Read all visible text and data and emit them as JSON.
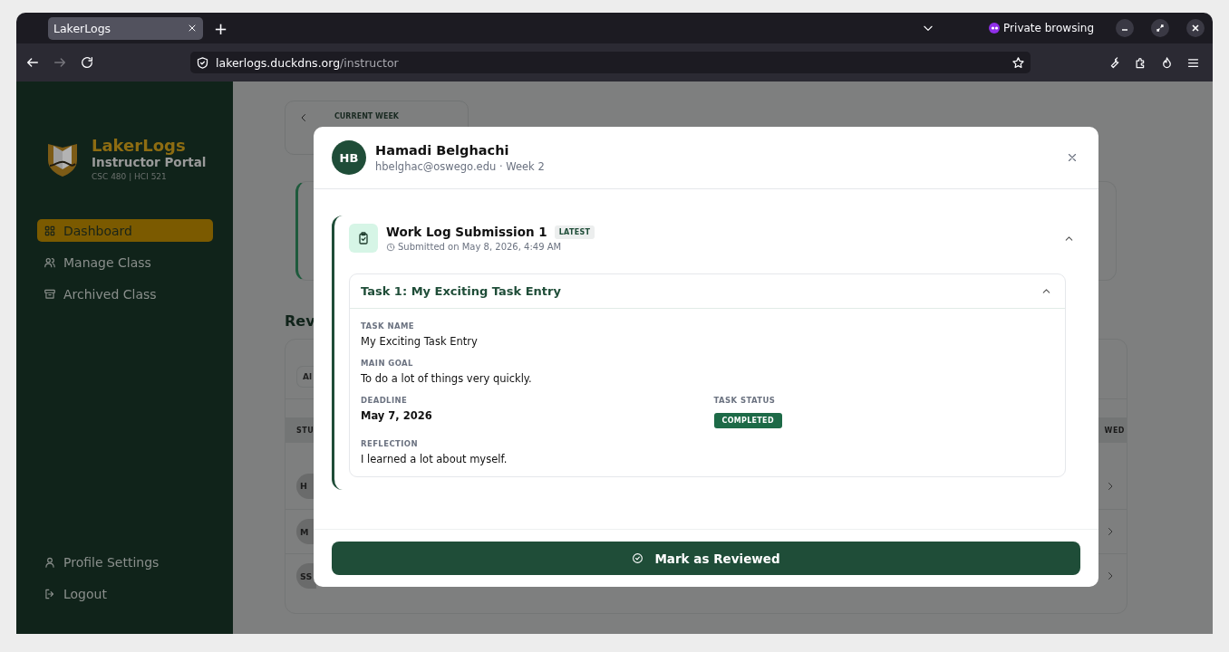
{
  "browser": {
    "tabs": [
      {
        "title": "LakerLogs",
        "selected": true
      }
    ],
    "new_tab": "+",
    "private_label": "Private browsing",
    "forward_disabled": true,
    "url": {
      "host": "lakerlogs.duckdns.org",
      "path": "/instructor"
    }
  },
  "sidebar": {
    "brand": "LakerLogs",
    "subtitle": "Instructor Portal",
    "courses": "CSC 480 | HCI 521",
    "nav": [
      {
        "label": "Dashboard",
        "selected": true
      },
      {
        "label": "Manage Class",
        "selected": false
      },
      {
        "label": "Archived Class",
        "selected": false
      }
    ],
    "footer_nav": [
      {
        "label": "Profile Settings"
      },
      {
        "label": "Logout"
      }
    ]
  },
  "background": {
    "week_label": "CURRENT WEEK",
    "heading": "Rev",
    "filter": "Al",
    "table_header": [
      "STU",
      "WED"
    ],
    "rows": [
      {
        "initials": "H"
      },
      {
        "initials": "M"
      },
      {
        "initials": "SS"
      }
    ]
  },
  "modal": {
    "initials": "HB",
    "name": "Hamadi Belghachi",
    "subtitle": "hbelghac@oswego.edu · Week 2",
    "submission": {
      "title": "Work Log Submission 1",
      "badge": "LATEST",
      "submitted": "Submitted on May 8, 2026, 4:49 AM",
      "expanded": true,
      "tasks": [
        {
          "title": "Task 1: My Exciting Task Entry",
          "expanded": true,
          "fields": [
            {
              "label": "TASK NAME",
              "value": "My Exciting Task Entry",
              "kind": "text"
            },
            {
              "label": "MAIN GOAL",
              "value": "To do a lot of things very quickly.",
              "kind": "text"
            },
            {
              "label": "DEADLINE",
              "value": "May 7, 2026",
              "kind": "date"
            },
            {
              "label": "TASK STATUS",
              "value": "COMPLETED",
              "kind": "status"
            },
            {
              "label": "REFLECTION",
              "value": "I learned a lot about myself.",
              "kind": "text"
            }
          ]
        }
      ]
    },
    "action": "Mark as Reviewed"
  }
}
